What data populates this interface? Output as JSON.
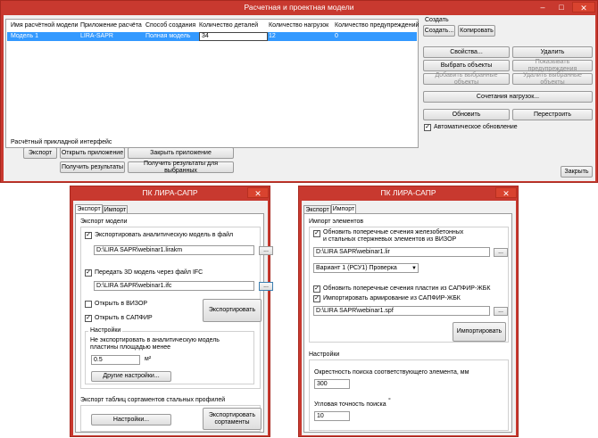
{
  "main_window": {
    "title": "Расчетная и проектная модели",
    "columns": [
      "Имя расчётной модели",
      "Приложение расчёта",
      "Способ создания",
      "Количество деталей",
      "Количество нагрузок",
      "Количество предупреждений"
    ],
    "row": {
      "name": "Модель 1",
      "app": "LIRA-SAPR",
      "method": "Полная модель",
      "details": "34",
      "loads": "12",
      "warnings": "0"
    },
    "create_group": "Создать",
    "buttons": {
      "create": "Создать...",
      "copy": "Копировать",
      "properties": "Свойства...",
      "delete": "Удалить",
      "select_objects": "Выбрать объекты",
      "show_warnings": "Показывать предупреждения",
      "add_selected": "Добавить выбранные объекты",
      "remove_selected": "Удалить выбранные объекты",
      "load_combinations": "Сочетания нагрузок...",
      "update": "Обновить",
      "recalculate": "Перестроить",
      "close": "Закрыть"
    },
    "auto_update_label": "Автоматическое обновление",
    "api_group": "Расчётный прикладной интерфейс",
    "api_buttons": {
      "export": "Экспорт",
      "open_app": "Открыть приложение",
      "close_app": "Закрыть приложение",
      "get_results": "Получить результаты",
      "get_results_selected": "Получить результаты для выбранных"
    }
  },
  "export_dialog": {
    "title": "ПК ЛИРА-САПР",
    "tabs": [
      "Экспорт",
      "Импорт"
    ],
    "model_group": "Экспорт модели",
    "export_analytic_label": "Экспортировать аналитическую модель в файл",
    "analytic_path": "D:\\LIRA SAPR\\webinar1.lirakm",
    "transfer_3d_label": "Передать 3D модель через файл IFC",
    "ifc_path": "D:\\LIRA SAPR\\webinar1.ifc",
    "open_vizor_label": "Открыть в ВИЗОР",
    "open_sapfir_label": "Открыть в САПФИР",
    "export_button": "Экспортировать",
    "settings_group": "Настройки",
    "no_export_label_1": "Не экспортировать в аналитическую модель",
    "no_export_label_2": "пластины площадью менее",
    "area_value": "0.5",
    "area_unit": "м²",
    "other_settings": "Другие настройки...",
    "profiles_group": "Экспорт таблиц сортаментов стальных профилей",
    "settings_button": "Настройки...",
    "export_profiles_1": "Экспортировать",
    "export_profiles_2": "сортаменты"
  },
  "import_dialog": {
    "title": "ПК ЛИРА-САПР",
    "tabs": [
      "Экспорт",
      "Импорт"
    ],
    "elements_group": "Импорт элементов",
    "update_sections_1": "Обновить поперечные сечения железобетонных",
    "update_sections_2": "и стальных стержневых элементов из ВИЗОР",
    "lir_path": "D:\\LIRA SAPR\\webinar1.lir",
    "variant_select": "Вариант 1 (РСУ1) Проверка",
    "update_plates_label": "Обновить поперечные сечения пластин из САПФИР-ЖБК",
    "import_reinf_label": "Импортировать армирование из САПФИР-ЖБК",
    "spf_path": "D:\\LIRA SAPR\\webinar1.spf",
    "import_button": "Импортировать",
    "settings_group": "Настройки",
    "radius_label": "Окрестность поиска соответствующего элемента, мм",
    "radius_value": "300",
    "angle_label": "Угловая точность поиска",
    "angle_unit": "°",
    "angle_value": "10"
  }
}
